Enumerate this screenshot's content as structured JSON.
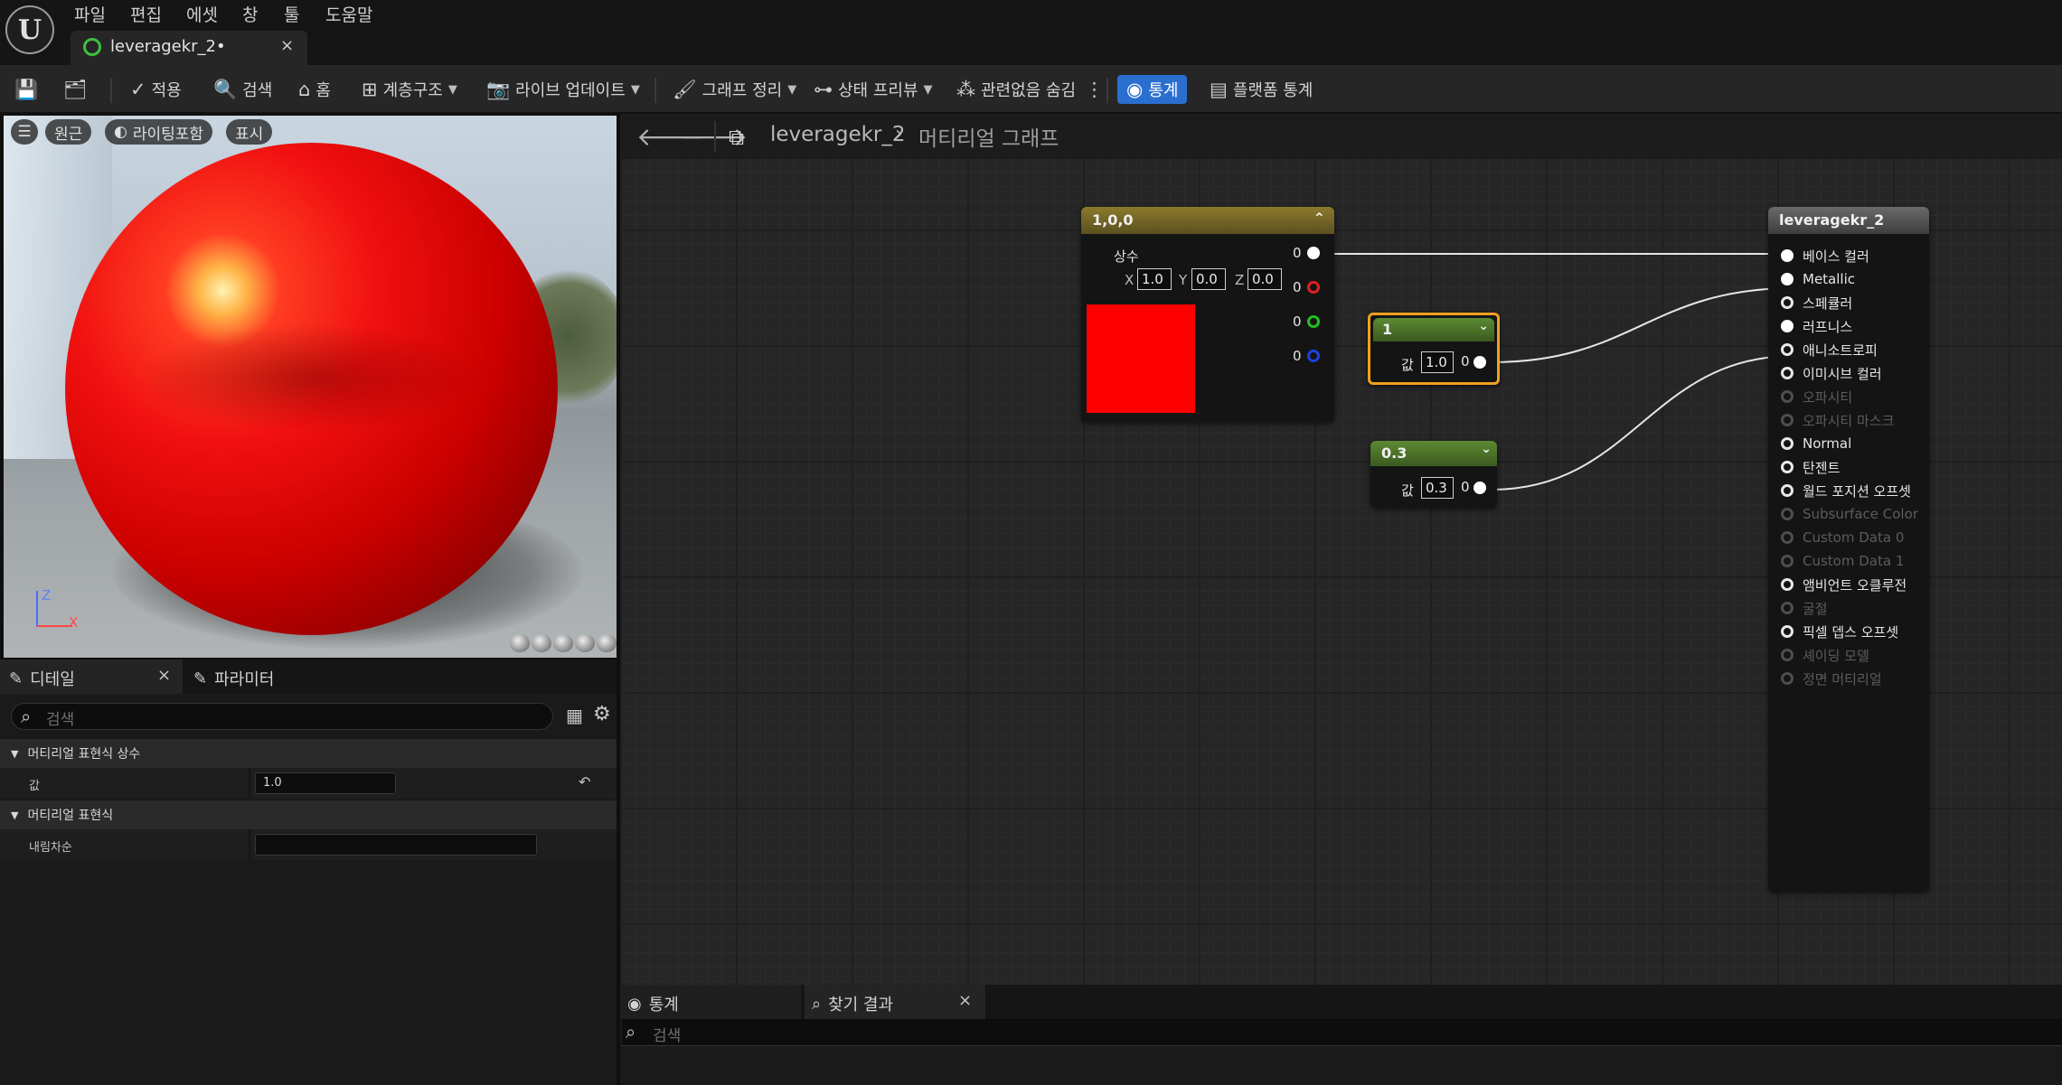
{
  "menu": {
    "logo": "U",
    "items": [
      "파일",
      "편집",
      "에셋",
      "창",
      "툴",
      "도움말"
    ]
  },
  "document_tab": {
    "label": "leveragekr_2•",
    "close": "×"
  },
  "toolbar": {
    "apply": "적용",
    "search": "검색",
    "home": "홈",
    "hierarchy": "계층구조",
    "live_update": "라이브 업데이트",
    "graph_cleanup": "그래프 정리",
    "state_preview": "상태 프리뷰",
    "hide_unrelated": "관련없음 숨김",
    "stats": "통계",
    "platform_stats": "플랫폼 통계"
  },
  "viewport": {
    "chips": [
      "원근",
      "라이팅포함",
      "표시"
    ],
    "axis_z": "Z",
    "axis_x": "X"
  },
  "details": {
    "tab_details": "디테일",
    "tab_params": "파라미터",
    "search_placeholder": "검색",
    "section1": "머티리얼 표현식 상수",
    "value_label": "값",
    "value": "1.0",
    "section2": "머티리얼 표현식",
    "desc_label": "내림차순",
    "desc_value": ""
  },
  "graph": {
    "crumb_asset": "leveragekr_2",
    "crumb_graph": "머티리얼 그래프",
    "const3": {
      "title": "1,0,0",
      "label": "상수",
      "x_label": "X",
      "x": "1.0",
      "y_label": "Y",
      "y": "0.0",
      "z_label": "Z",
      "z": "0.0",
      "outputs": [
        "0",
        "0",
        "0",
        "0"
      ],
      "color": "#ff0000"
    },
    "const1": {
      "title": "1",
      "val_label": "값",
      "value": "1.0",
      "out": "0"
    },
    "const2": {
      "title": "0.3",
      "val_label": "값",
      "value": "0.3",
      "out": "0"
    },
    "material": {
      "title": "leveragekr_2",
      "pins": [
        {
          "label": "베이스 컬러",
          "active": true
        },
        {
          "label": "Metallic",
          "active": true
        },
        {
          "label": "스페큘러",
          "active": true
        },
        {
          "label": "러프니스",
          "active": true
        },
        {
          "label": "애니소트로피",
          "active": true
        },
        {
          "label": "이미시브 컬러",
          "active": true
        },
        {
          "label": "오파시티",
          "active": false
        },
        {
          "label": "오파시티 마스크",
          "active": false
        },
        {
          "label": "Normal",
          "active": true
        },
        {
          "label": "탄젠트",
          "active": true
        },
        {
          "label": "월드 포지션 오프셋",
          "active": true
        },
        {
          "label": "Subsurface Color",
          "active": false
        },
        {
          "label": "Custom Data 0",
          "active": false
        },
        {
          "label": "Custom Data 1",
          "active": false
        },
        {
          "label": "앰비언트 오클루전",
          "active": true
        },
        {
          "label": "굴절",
          "active": false
        },
        {
          "label": "픽셀 뎁스 오프셋",
          "active": true
        },
        {
          "label": "셰이딩 모델",
          "active": false
        },
        {
          "label": "정면 머티리얼",
          "active": false
        }
      ]
    }
  },
  "bottom": {
    "tab_stats": "통계",
    "tab_find": "찾기 결과",
    "close": "×",
    "search_placeholder": "검색"
  }
}
